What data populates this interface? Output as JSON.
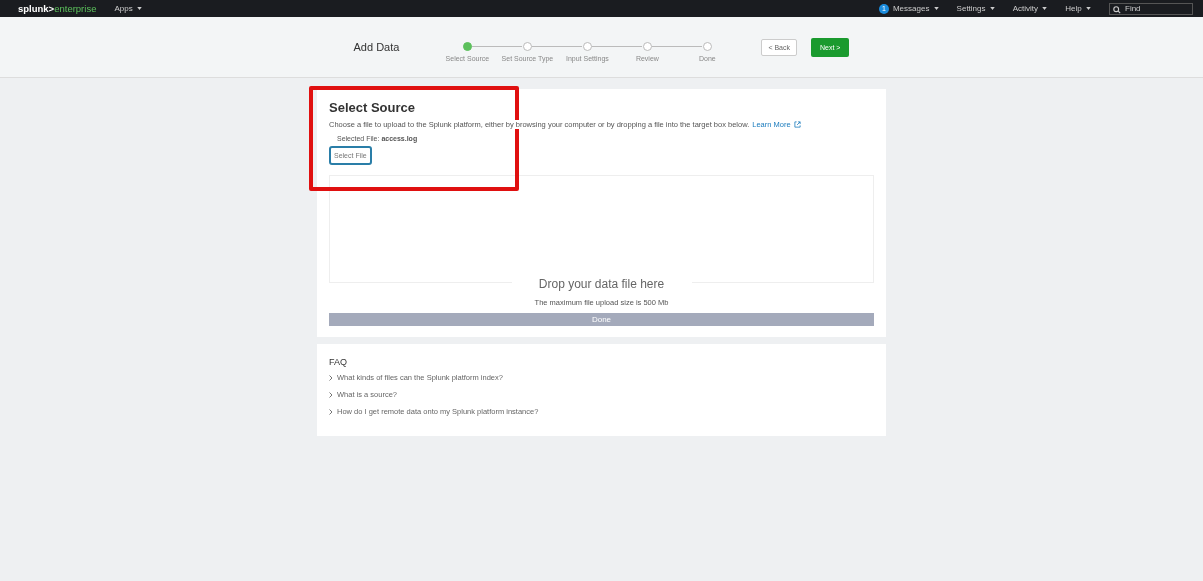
{
  "topbar": {
    "brand_left": "splunk>",
    "brand_right": "enterprise",
    "apps_menu": "Apps",
    "messages_count": "1",
    "menus": [
      "Messages",
      "Settings",
      "Activity",
      "Help"
    ],
    "search": {
      "placeholder": "Find"
    }
  },
  "wizard": {
    "title": "Add Data",
    "steps": [
      {
        "label": "Select Source",
        "selected": true
      },
      {
        "label": "Set Source Type",
        "selected": false
      },
      {
        "label": "Input Settings",
        "selected": false
      },
      {
        "label": "Review",
        "selected": false
      },
      {
        "label": "Done",
        "selected": false
      }
    ],
    "back_button": "< Back",
    "next_button": "Next >"
  },
  "select_source": {
    "title": "Select Source",
    "description": "Choose a file to upload to the Splunk platform, either by browsing your computer or by dropping a file into the target box below.",
    "learn_more": "Learn More",
    "selected_file_label": "Selected File:",
    "selected_file": "access.log",
    "select_button": "Select File",
    "highlighted": true
  },
  "drop_zone": {
    "heading": "Drop your data file here",
    "note": "The maximum file upload size is 500 Mb",
    "progress_label": "Done",
    "level": 1
  },
  "faq": {
    "title": "FAQ",
    "items": [
      "What kinds of files can the Splunk platform index?",
      "What is a source?",
      "How do I get remote data onto my Splunk platform instance?"
    ]
  }
}
